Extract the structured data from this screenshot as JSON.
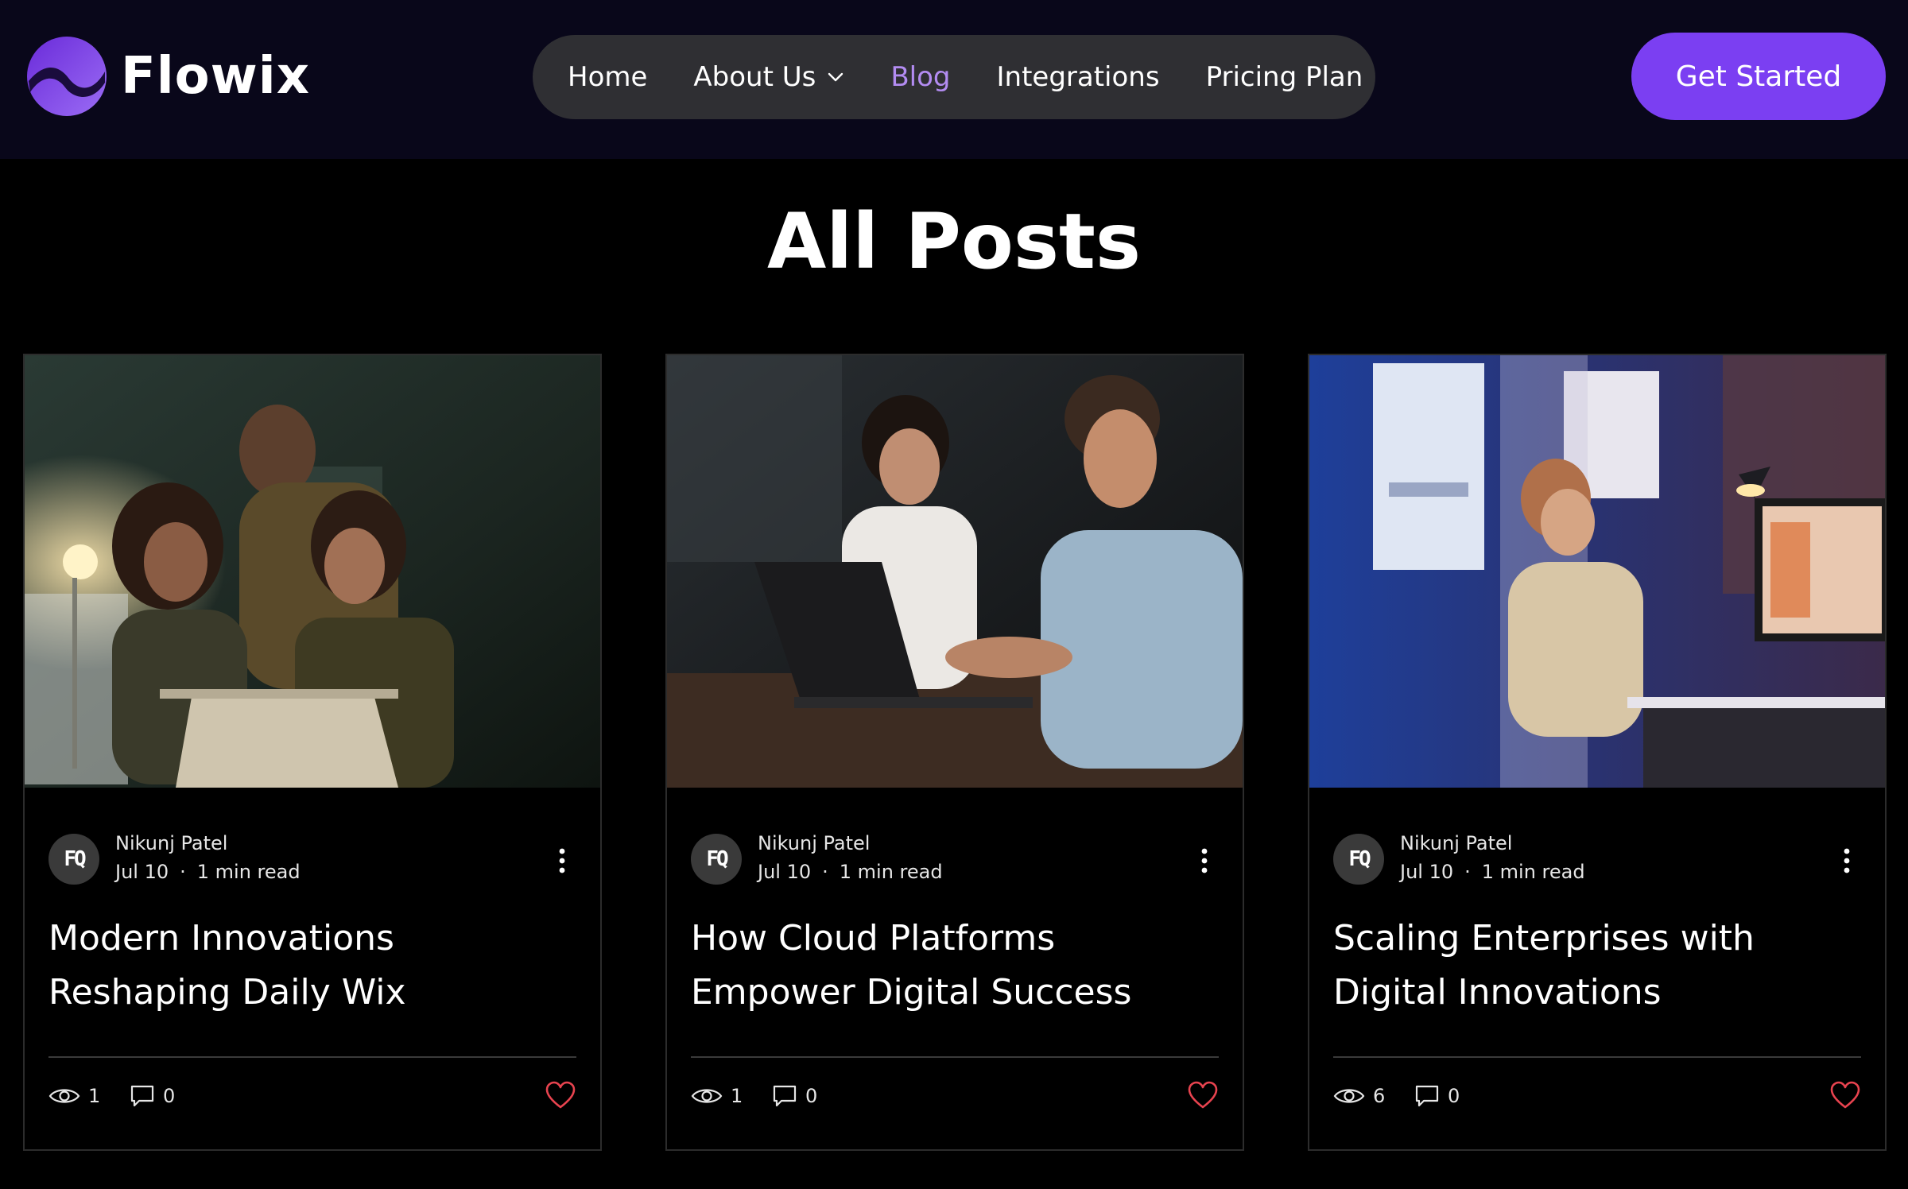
{
  "brand": {
    "name": "Flowix",
    "accent_color": "#7b3ff2"
  },
  "nav": {
    "items": [
      {
        "label": "Home",
        "active": false
      },
      {
        "label": "About Us",
        "has_dropdown": true,
        "active": false
      },
      {
        "label": "Blog",
        "active": true
      },
      {
        "label": "Integrations",
        "active": false
      },
      {
        "label": "Pricing Plan",
        "active": false
      }
    ],
    "active_color": "#b38cf2"
  },
  "cta": {
    "label": "Get Started"
  },
  "page": {
    "title": "All Posts"
  },
  "posts": [
    {
      "image_icon": "team-at-laptop-photo",
      "author": {
        "initials": "FQ",
        "name": "Nikunj Patel"
      },
      "date": "Jul 10",
      "read_time": "1 min read",
      "title": "Modern Innovations Reshaping Daily Wix",
      "views": "1",
      "comments": "0"
    },
    {
      "image_icon": "two-people-night-laptop-photo",
      "author": {
        "initials": "FQ",
        "name": "Nikunj Patel"
      },
      "date": "Jul 10",
      "read_time": "1 min read",
      "title": "How Cloud Platforms Empower Digital Success",
      "views": "1",
      "comments": "0"
    },
    {
      "image_icon": "woman-at-monitor-photo",
      "author": {
        "initials": "FQ",
        "name": "Nikunj Patel"
      },
      "date": "Jul 10",
      "read_time": "1 min read",
      "title": "Scaling Enterprises with Digital Innovations",
      "views": "6",
      "comments": "0"
    }
  ],
  "like_color": "#e8434f"
}
